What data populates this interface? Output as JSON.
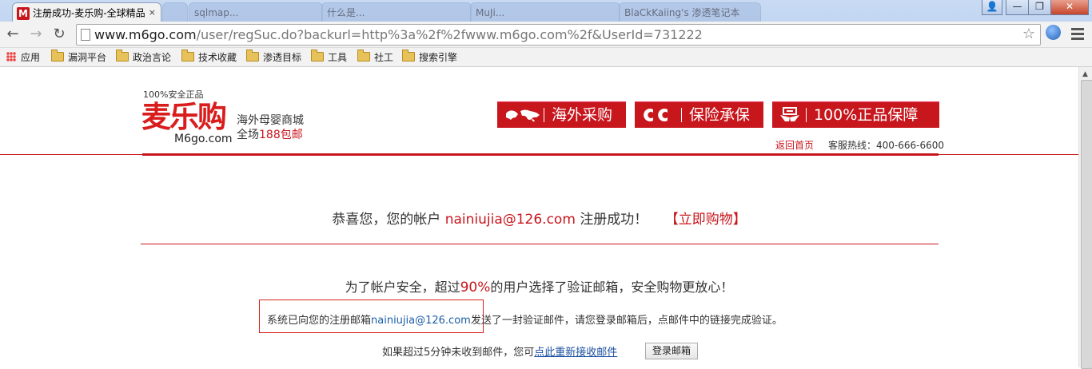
{
  "browser": {
    "active_tab": {
      "title": "注册成功-麦乐购-全球精品",
      "favicon": "M",
      "close": "×"
    },
    "inactive_tabs": [
      "",
      "sqlmap...",
      "什么是...",
      "MuJi...",
      "BlaCkKaiing's 渗透笔记本"
    ],
    "window_controls": {
      "user": "👤",
      "minimize": "—",
      "restore": "❐",
      "close": "✕"
    },
    "nav": {
      "back": "←",
      "forward": "→",
      "reload": "↻"
    },
    "url": {
      "host": "www.m6go.com",
      "path": "/user/regSuc.do?backurl=http%3a%2f%2fwww.m6go.com%2f&UserId=731222"
    },
    "bookmarks": [
      "应用",
      "漏洞平台",
      "政治言论",
      "技术收藏",
      "渗透目标",
      "工具",
      "社工",
      "搜索引擎"
    ]
  },
  "header": {
    "tagline": "100%安全正品",
    "logo_text": "麦乐购",
    "logo_domain": "M6go.com",
    "slogan_line1": "海外母婴商城",
    "slogan_line2_prefix": "全场",
    "slogan_line2_highlight": "188包邮",
    "badges": [
      {
        "icon": "world-map-icon",
        "label": "海外采购"
      },
      {
        "icon": "insurance-logo-icon",
        "label": "保险承保"
      },
      {
        "icon": "certified-hands-icon",
        "label": "100%正品保障"
      }
    ],
    "home_link": "返回首页",
    "hotline_label": "客服热线：",
    "hotline_number": "400-666-6600"
  },
  "main": {
    "success_prefix": "恭喜您，您的帐户",
    "email": "nainiujia@126.com",
    "success_suffix": "注册成功！",
    "shop_now": "【立即购物】",
    "security_prefix": "为了帐户安全，超过",
    "security_percent": "90%",
    "security_suffix": "的用户选择了验证邮箱，安全购物更放心！",
    "sent_prefix": "系统已向您的注册邮箱",
    "sent_suffix": "发送了一封验证邮件，请您登录邮箱后，点邮件中的链接完成验证。",
    "resend_prefix": "如果超过5分钟未收到邮件，您可",
    "resend_link": "点此重新接收邮件",
    "login_button": "登录邮箱"
  },
  "colors": {
    "brand_red": "#c8161d",
    "link_blue": "#1a4fa0"
  }
}
